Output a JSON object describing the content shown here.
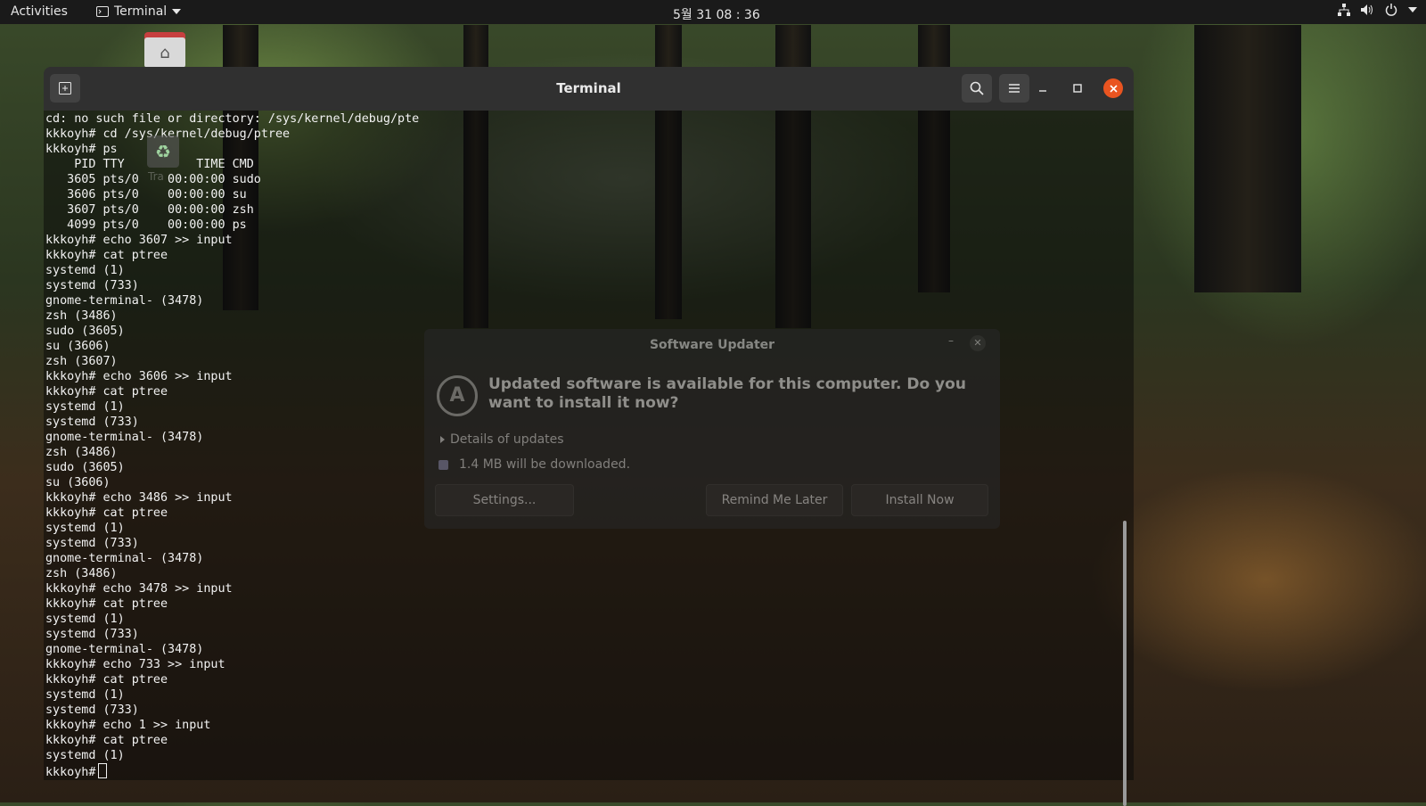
{
  "topbar": {
    "activities": "Activities",
    "app_name": "Terminal",
    "clock": "5월 31 08 : 36"
  },
  "desktop": {
    "trash_label": "Tra"
  },
  "terminal": {
    "title": "Terminal",
    "prompt": "kkkoyh#",
    "lines": [
      "cd: no such file or directory: /sys/kernel/debug/pte",
      "kkkoyh# cd /sys/kernel/debug/ptree",
      "kkkoyh# ps",
      "    PID TTY          TIME CMD",
      "   3605 pts/0    00:00:00 sudo",
      "   3606 pts/0    00:00:00 su",
      "   3607 pts/0    00:00:00 zsh",
      "   4099 pts/0    00:00:00 ps",
      "kkkoyh# echo 3607 >> input",
      "kkkoyh# cat ptree",
      "systemd (1)",
      "systemd (733)",
      "gnome-terminal- (3478)",
      "zsh (3486)",
      "sudo (3605)",
      "su (3606)",
      "zsh (3607)",
      "kkkoyh# echo 3606 >> input",
      "kkkoyh# cat ptree",
      "systemd (1)",
      "systemd (733)",
      "gnome-terminal- (3478)",
      "zsh (3486)",
      "sudo (3605)",
      "su (3606)",
      "kkkoyh# echo 3486 >> input",
      "kkkoyh# cat ptree",
      "systemd (1)",
      "systemd (733)",
      "gnome-terminal- (3478)",
      "zsh (3486)",
      "kkkoyh# echo 3478 >> input",
      "kkkoyh# cat ptree",
      "systemd (1)",
      "systemd (733)",
      "gnome-terminal- (3478)",
      "kkkoyh# echo 733 >> input",
      "kkkoyh# cat ptree",
      "systemd (1)",
      "systemd (733)",
      "kkkoyh# echo 1 >> input",
      "kkkoyh# cat ptree",
      "systemd (1)"
    ]
  },
  "updater": {
    "title": "Software Updater",
    "heading": "Updated software is available for this computer. Do you want to install it now?",
    "details": "Details of updates",
    "size": "1.4 MB will be downloaded.",
    "settings_button": "Settings...",
    "remind_button": "Remind Me Later",
    "install_button": "Install Now"
  }
}
